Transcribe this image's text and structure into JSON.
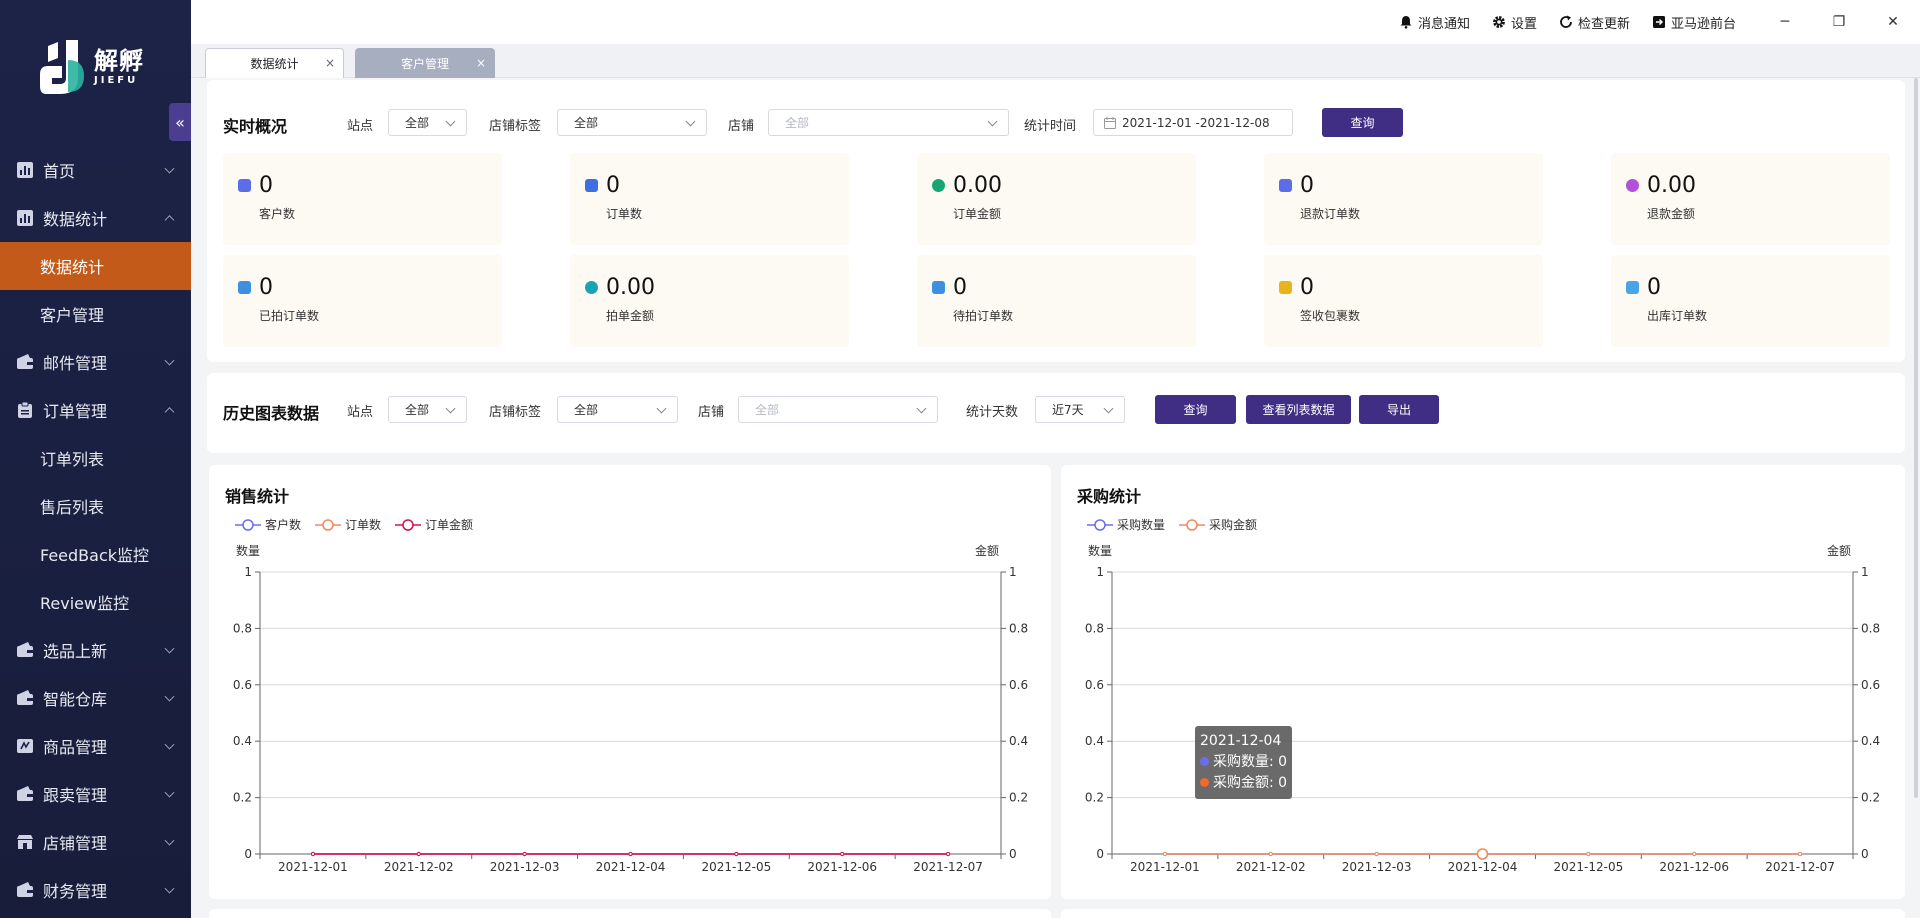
{
  "logo": {
    "cn": "解孵",
    "en": "JIEFU"
  },
  "sidebar": {
    "items": [
      {
        "label": "首页",
        "icon": "chart-bar-icon",
        "chev": "down"
      },
      {
        "label": "数据统计",
        "icon": "chart-bar-icon",
        "chev": "up"
      },
      {
        "label": "数据统计",
        "sub": true,
        "active": true
      },
      {
        "label": "客户管理",
        "sub": true
      },
      {
        "label": "邮件管理",
        "icon": "wallet-icon",
        "chev": "down"
      },
      {
        "label": "订单管理",
        "icon": "clipboard-icon",
        "chev": "up"
      },
      {
        "label": "订单列表",
        "sub": true
      },
      {
        "label": "售后列表",
        "sub": true
      },
      {
        "label": "FeedBack监控",
        "sub": true
      },
      {
        "label": "Review监控",
        "sub": true
      },
      {
        "label": "选品上新",
        "icon": "wallet-icon",
        "chev": "down"
      },
      {
        "label": "智能仓库",
        "icon": "wallet-icon",
        "chev": "down"
      },
      {
        "label": "商品管理",
        "icon": "goods-icon",
        "chev": "down"
      },
      {
        "label": "跟卖管理",
        "icon": "wallet-icon",
        "chev": "down"
      },
      {
        "label": "店铺管理",
        "icon": "store-icon",
        "chev": "down"
      },
      {
        "label": "财务管理",
        "icon": "wallet-icon",
        "chev": "down"
      }
    ]
  },
  "titlebar": {
    "notify": "消息通知",
    "settings": "设置",
    "update": "检查更新",
    "amazon": "亚马逊前台",
    "minimize": "─",
    "restore": "❐",
    "close": "✕"
  },
  "tabs": [
    {
      "label": "数据统计",
      "active": true
    },
    {
      "label": "客户管理",
      "active": false
    }
  ],
  "tab_close": "×",
  "collapse": "«",
  "realtime": {
    "title": "实时概况",
    "site_label": "站点",
    "site_value": "全部",
    "tag_label": "店铺标签",
    "tag_value": "全部",
    "shop_label": "店铺",
    "shop_placeholder": "全部",
    "time_label": "统计时间",
    "date_range": "2021-12-01  -2021-12-08",
    "query": "查询",
    "cards": [
      {
        "value": "0",
        "label": "客户数",
        "color": "#5b6ee8"
      },
      {
        "value": "0",
        "label": "订单数",
        "color": "#3d6fe0"
      },
      {
        "value": "0.00",
        "label": "订单金额",
        "color": "#17a673"
      },
      {
        "value": "0",
        "label": "退款订单数",
        "color": "#5b6ee8"
      },
      {
        "value": "0.00",
        "label": "退款金额",
        "color": "#b150d8"
      },
      {
        "value": "0",
        "label": "已拍订单数",
        "color": "#3d8fe0"
      },
      {
        "value": "0.00",
        "label": "拍单金额",
        "color": "#1aa3b8"
      },
      {
        "value": "0",
        "label": "待拍订单数",
        "color": "#3d8fe0"
      },
      {
        "value": "0",
        "label": "签收包裹数",
        "color": "#e8b41d"
      },
      {
        "value": "0",
        "label": "出库订单数",
        "color": "#4aa3e8"
      }
    ]
  },
  "history": {
    "title": "历史图表数据",
    "site_label": "站点",
    "site_value": "全部",
    "tag_label": "店铺标签",
    "tag_value": "全部",
    "shop_label": "店铺",
    "shop_placeholder": "全部",
    "days_label": "统计天数",
    "days_value": "近7天",
    "query": "查询",
    "view_list": "查看列表数据",
    "export": "导出"
  },
  "chart_data": [
    {
      "type": "line",
      "title": "销售统计",
      "ylabel": "数量",
      "y2label": "金额",
      "x": [
        "2021-12-01",
        "2021-12-02",
        "2021-12-03",
        "2021-12-04",
        "2021-12-05",
        "2021-12-06",
        "2021-12-07"
      ],
      "ylim": [
        0,
        1
      ],
      "y2lim": [
        0,
        1
      ],
      "yticks": [
        "1",
        "0.8",
        "0.6",
        "0.4",
        "0.2",
        "0"
      ],
      "grid": true,
      "legend_position": "top-left",
      "series": [
        {
          "name": "客户数",
          "values": [
            0,
            0,
            0,
            0,
            0,
            0,
            0
          ],
          "color": "#6a6ee8"
        },
        {
          "name": "订单数",
          "values": [
            0,
            0,
            0,
            0,
            0,
            0,
            0
          ],
          "color": "#f08a5a"
        },
        {
          "name": "订单金额",
          "values": [
            0,
            0,
            0,
            0,
            0,
            0,
            0
          ],
          "color": "#d0124e"
        }
      ]
    },
    {
      "type": "line",
      "title": "采购统计",
      "ylabel": "数量",
      "y2label": "金额",
      "x": [
        "2021-12-01",
        "2021-12-02",
        "2021-12-03",
        "2021-12-04",
        "2021-12-05",
        "2021-12-06",
        "2021-12-07"
      ],
      "ylim": [
        0,
        1
      ],
      "y2lim": [
        0,
        1
      ],
      "yticks": [
        "1",
        "0.8",
        "0.6",
        "0.4",
        "0.2",
        "0"
      ],
      "grid": true,
      "legend_position": "top-left",
      "series": [
        {
          "name": "采购数量",
          "values": [
            0,
            0,
            0,
            0,
            0,
            0,
            0
          ],
          "color": "#6a6ee8"
        },
        {
          "name": "采购金额",
          "values": [
            0,
            0,
            0,
            0,
            0,
            0,
            0
          ],
          "color": "#f08a5a"
        }
      ],
      "tooltip": {
        "title": "2021-12-04",
        "rows": [
          {
            "text": "采购数量: 0",
            "color": "#6a6ee8"
          },
          {
            "text": "采购金额: 0",
            "color": "#f06a2a"
          }
        ]
      }
    }
  ]
}
